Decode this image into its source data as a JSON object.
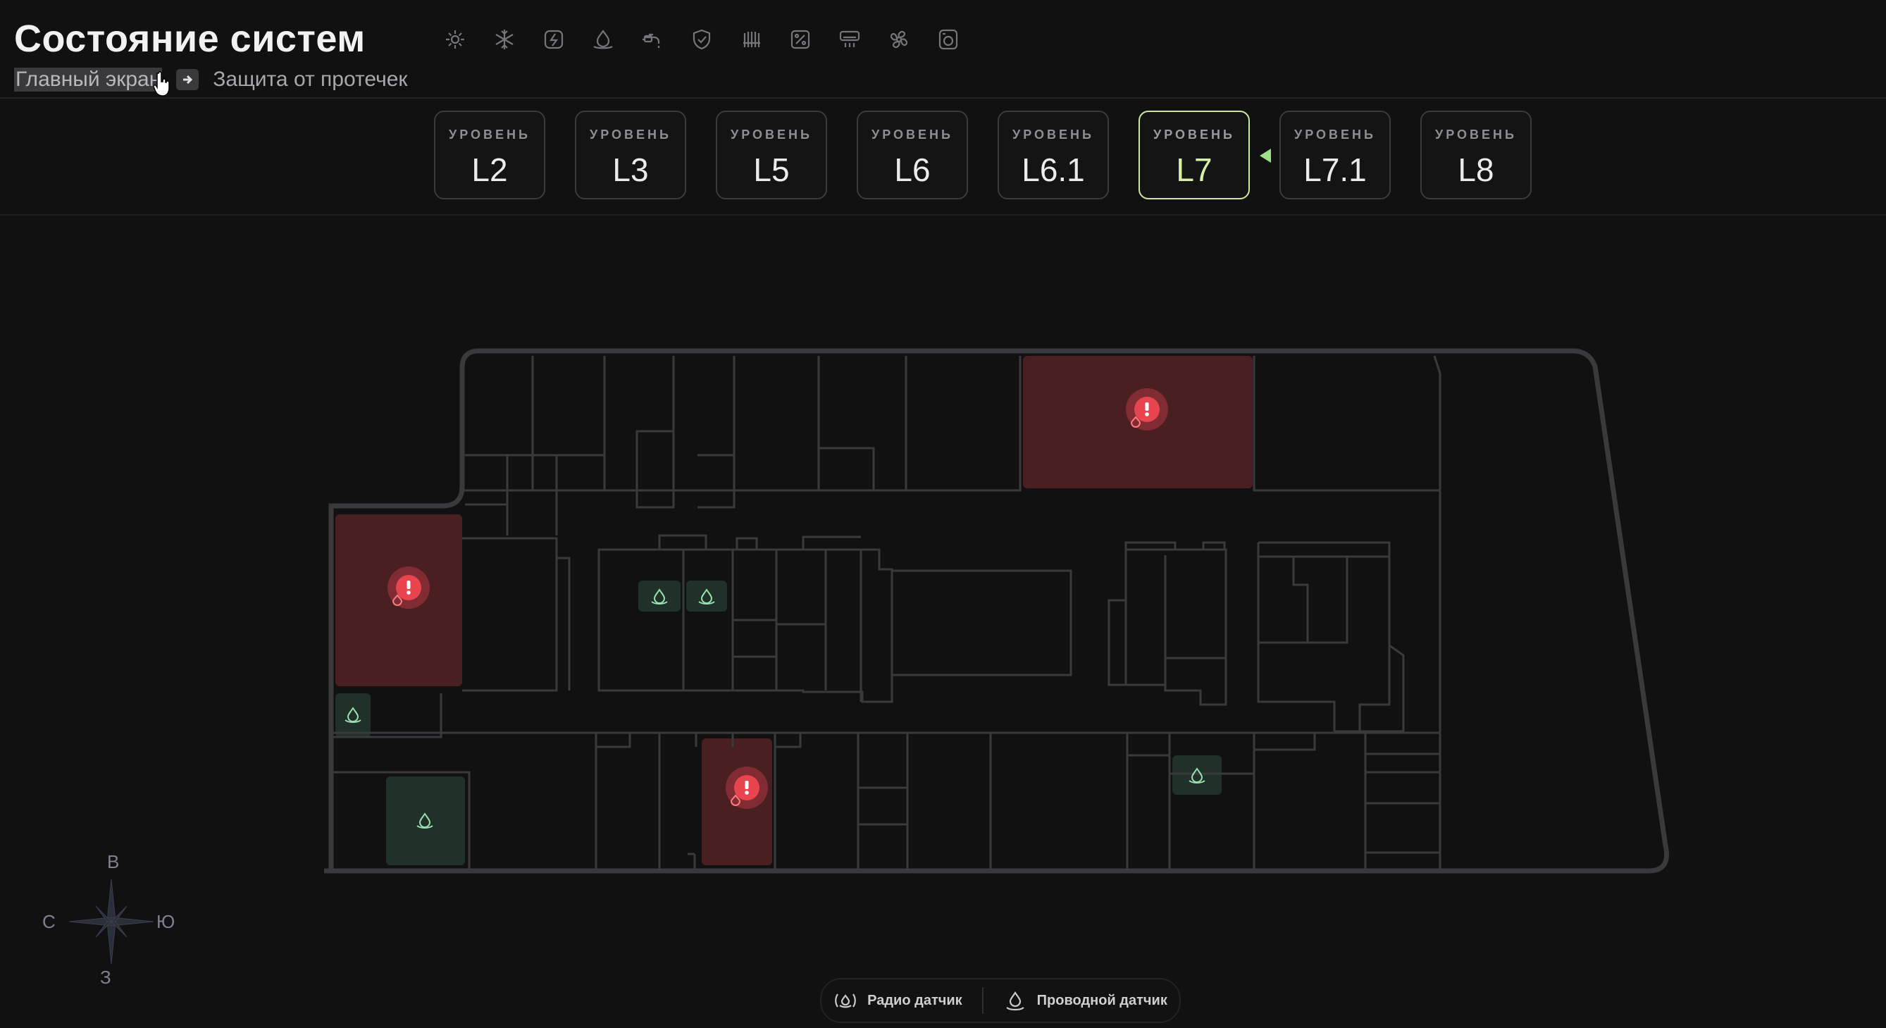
{
  "header": {
    "title": "Состояние систем",
    "breadcrumb_home": "Главный экран",
    "breadcrumb_current": "Защита от протечек",
    "system_icons": [
      "sun-icon",
      "snowflake-icon",
      "power-icon",
      "water-drop-icon",
      "faucet-icon",
      "shield-icon",
      "radiator-icon",
      "humidity-icon",
      "air-conditioner-icon",
      "fan-icon",
      "washer-icon"
    ]
  },
  "levels": {
    "caption": "УРОВЕНЬ",
    "items": [
      "L2",
      "L3",
      "L5",
      "L6",
      "L6.1",
      "L7",
      "L7.1",
      "L8"
    ],
    "active": "L7"
  },
  "compass": {
    "north": "С",
    "south": "Ю",
    "east": "В",
    "west": "З"
  },
  "legend": {
    "radio": "Радио датчик",
    "wired": "Проводной датчик"
  },
  "colors": {
    "alert": "#e8454f",
    "alert_room": "#4a1f22",
    "ok_room": "#1f3128",
    "ok_icon": "#9be0b0",
    "active_level": "#cfe8a0"
  }
}
